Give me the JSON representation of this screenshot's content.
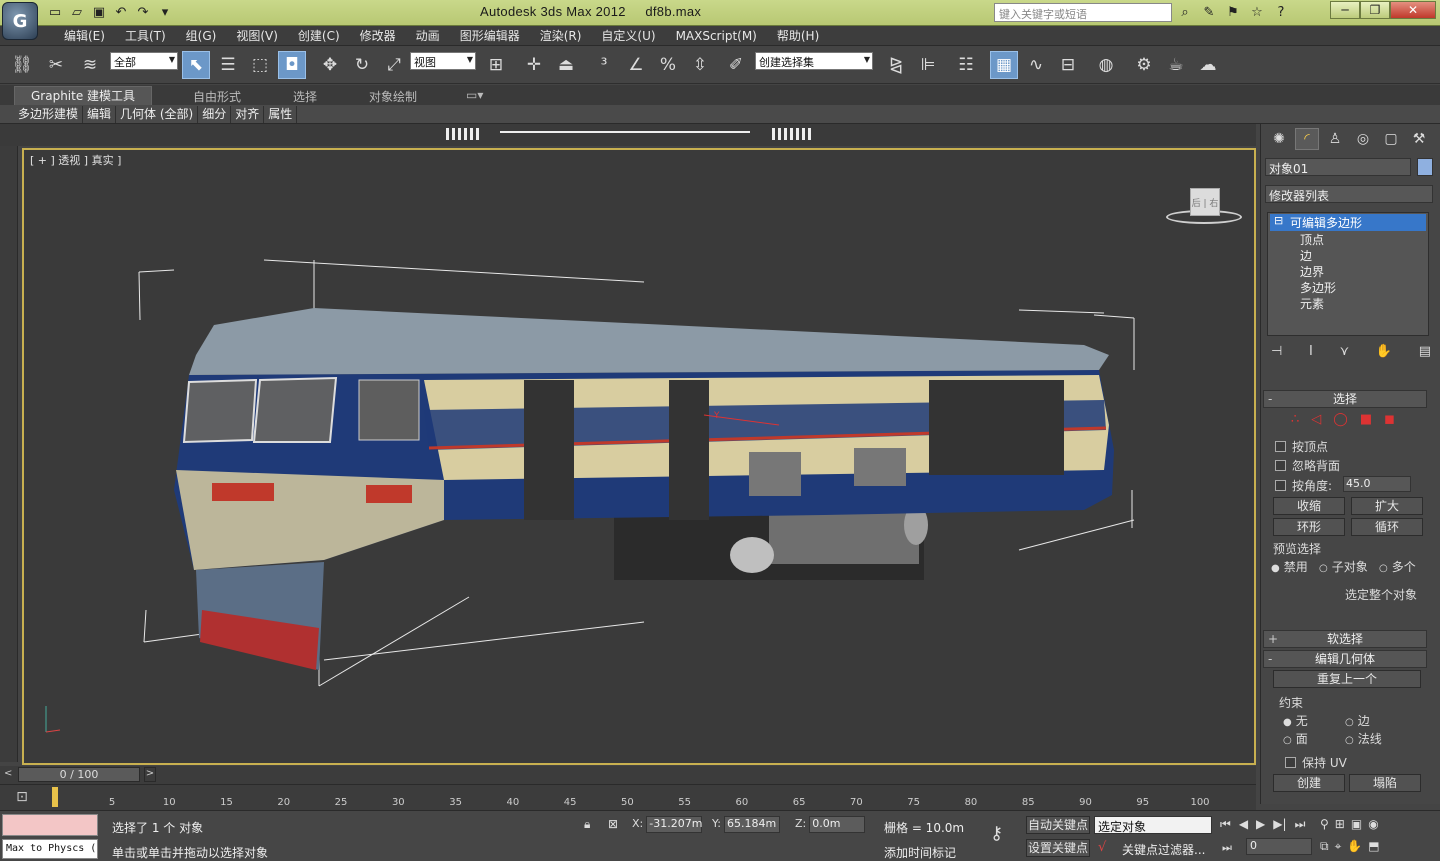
{
  "title": {
    "app": "Autodesk 3ds Max  2012",
    "file": "df8b.max"
  },
  "search": {
    "placeholder": "键入关键字或短语"
  },
  "menu": [
    "编辑(E)",
    "工具(T)",
    "组(G)",
    "视图(V)",
    "创建(C)",
    "修改器",
    "动画",
    "图形编辑器",
    "渲染(R)",
    "自定义(U)",
    "MAXScript(M)",
    "帮助(H)"
  ],
  "toolbar": {
    "filter": "全部",
    "refcoord": "视图",
    "selset": "创建选择集"
  },
  "ribbon": {
    "tabs": [
      "Graphite 建模工具",
      "自由形式",
      "选择",
      "对象绘制"
    ],
    "sub": [
      "多边形建模",
      "编辑",
      "几何体 (全部)",
      "细分",
      "对齐",
      "属性"
    ]
  },
  "viewport": {
    "label": "[ + ] 透视 ] 真实 ]",
    "viewcube": "后 | 右"
  },
  "cmd": {
    "object_name": "对象01",
    "modifier_list": "修改器列表",
    "stack": [
      "可编辑多边形",
      "顶点",
      "边",
      "边界",
      "多边形",
      "元素"
    ],
    "select_rollout": "选择",
    "by_vertex": "按顶点",
    "ignore_back": "忽略背面",
    "by_angle": "按角度:",
    "angle_value": "45.0",
    "shrink": "收缩",
    "grow": "扩大",
    "ring": "环形",
    "loop": "循环",
    "preview": "预览选择",
    "preview_off": "禁用",
    "preview_sub": "子对象",
    "preview_multi": "多个",
    "select_whole": "选定整个对象",
    "soft_select": "软选择",
    "edit_geom": "编辑几何体",
    "repeat_last": "重复上一个",
    "constraints": "约束",
    "c_none": "无",
    "c_edge": "边",
    "c_face": "面",
    "c_normal": "法线",
    "preserve_uv": "保持 UV",
    "create": "创建",
    "collapse": "塌陷"
  },
  "timeline": {
    "frame": "0 / 100",
    "ticks": [
      "5",
      "10",
      "15",
      "20",
      "25",
      "30",
      "35",
      "40",
      "45",
      "50",
      "55",
      "60",
      "65",
      "70",
      "75",
      "80",
      "85",
      "90",
      "95",
      "100"
    ]
  },
  "status": {
    "selected": "选择了 1 个 对象",
    "hint": "单击或单击并拖动以选择对象",
    "maxscript": "Max to Physcs (",
    "x": "-31.207m",
    "y": "65.184m",
    "z": "0.0m",
    "grid": "栅格 = 10.0m",
    "autokey": "自动关键点",
    "setkey": "设置关键点",
    "keyset": "选定对象",
    "keyfilters": "关键点过滤器...",
    "addtime": "添加时间标记",
    "frame_field": "0"
  }
}
